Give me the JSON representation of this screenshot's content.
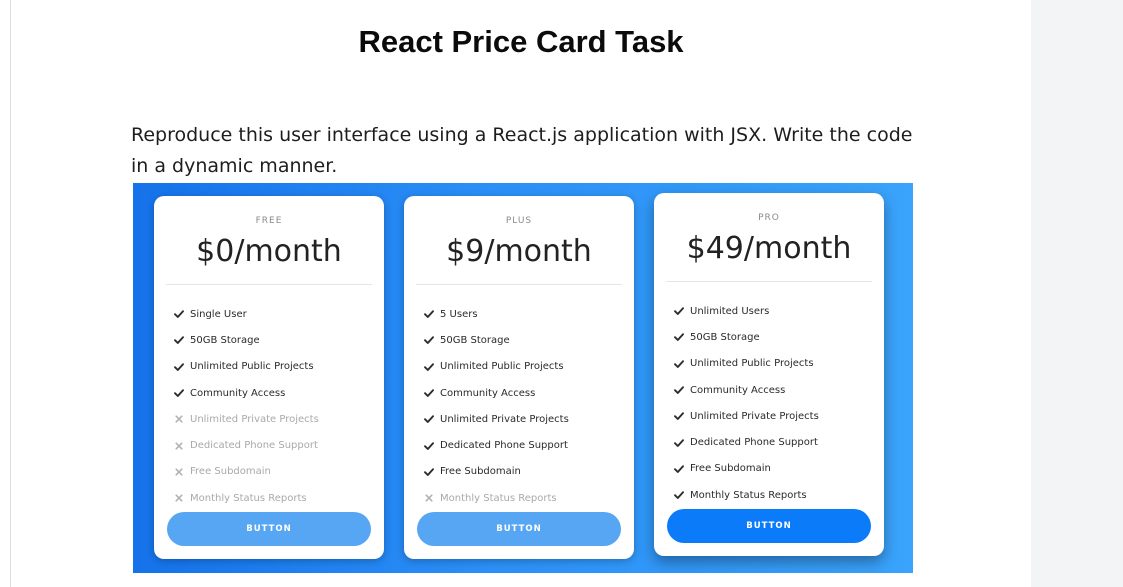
{
  "page": {
    "title": "React Price Card Task"
  },
  "description": "Reproduce this user interface using a React.js application with JSX. Write the code in a dynamic manner.",
  "colors": {
    "gradient_start": "#1572ea",
    "gradient_end": "#3aa3fb",
    "check": "#2c2c2c",
    "cross": "#b3b3b3",
    "button": "#56a6f4",
    "button_highlight": "#0b7bfa"
  },
  "cards": [
    {
      "tier": "FREE",
      "price": "$0/month",
      "button": "BUTTON",
      "features": [
        {
          "label": "Single User",
          "included": true
        },
        {
          "label": "50GB Storage",
          "included": true
        },
        {
          "label": "Unlimited Public Projects",
          "included": true
        },
        {
          "label": "Community Access",
          "included": true
        },
        {
          "label": "Unlimited Private Projects",
          "included": false
        },
        {
          "label": "Dedicated Phone Support",
          "included": false
        },
        {
          "label": "Free Subdomain",
          "included": false
        },
        {
          "label": "Monthly Status Reports",
          "included": false
        }
      ]
    },
    {
      "tier": "PLUS",
      "price": "$9/month",
      "button": "BUTTON",
      "features": [
        {
          "label": "5 Users",
          "included": true
        },
        {
          "label": "50GB Storage",
          "included": true
        },
        {
          "label": "Unlimited Public Projects",
          "included": true
        },
        {
          "label": "Community Access",
          "included": true
        },
        {
          "label": "Unlimited Private Projects",
          "included": true
        },
        {
          "label": "Dedicated Phone Support",
          "included": true
        },
        {
          "label": "Free Subdomain",
          "included": true
        },
        {
          "label": "Monthly Status Reports",
          "included": false
        }
      ]
    },
    {
      "tier": "PRO",
      "price": "$49/month",
      "button": "BUTTON",
      "features": [
        {
          "label": "Unlimited Users",
          "included": true
        },
        {
          "label": "50GB Storage",
          "included": true
        },
        {
          "label": "Unlimited Public Projects",
          "included": true
        },
        {
          "label": "Community Access",
          "included": true
        },
        {
          "label": "Unlimited Private Projects",
          "included": true
        },
        {
          "label": "Dedicated Phone Support",
          "included": true
        },
        {
          "label": "Free Subdomain",
          "included": true
        },
        {
          "label": "Monthly Status Reports",
          "included": true
        }
      ]
    }
  ]
}
